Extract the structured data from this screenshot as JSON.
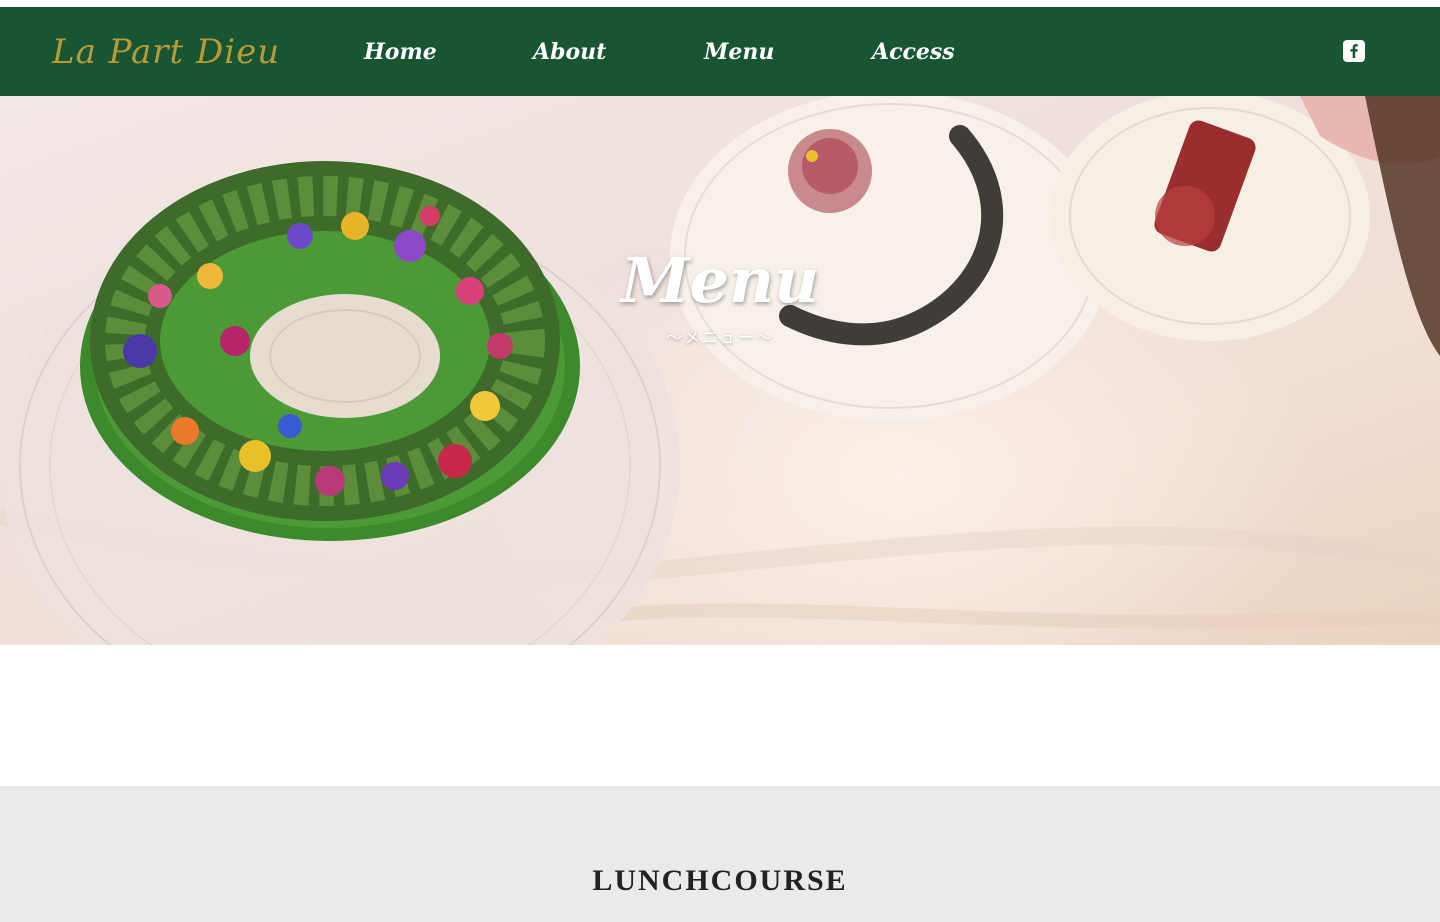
{
  "brand": {
    "name": "La Part Dieu",
    "color": "#b89a38"
  },
  "nav": {
    "background": "#175533",
    "items": [
      {
        "label": "Home"
      },
      {
        "label": "About"
      },
      {
        "label": "Menu"
      },
      {
        "label": "Access"
      }
    ],
    "social": {
      "icon": "facebook-icon"
    }
  },
  "hero": {
    "title": "Menu",
    "subtitle": "〜メニュー〜"
  },
  "section": {
    "title": "LUNCHCOURSE",
    "background": "#eaeaea"
  }
}
